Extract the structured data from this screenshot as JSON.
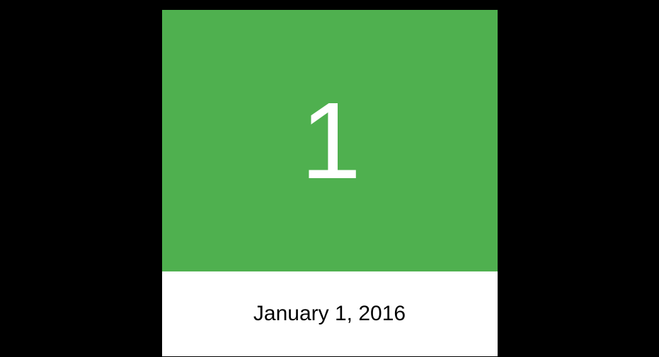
{
  "card": {
    "number": "1",
    "date": "January 1, 2016",
    "accent_color": "#4fb04f"
  }
}
